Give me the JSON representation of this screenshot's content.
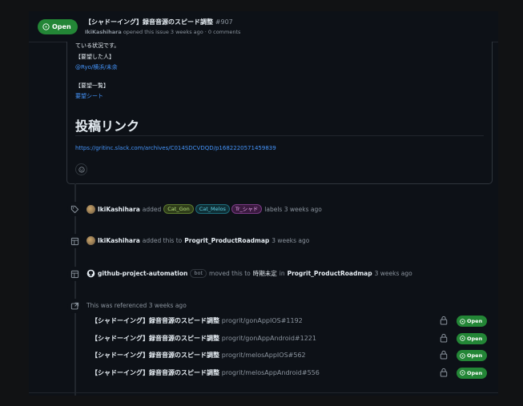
{
  "header": {
    "state_label": "Open",
    "title": "【シャドーイング】録音音源のスピード調整",
    "number": "#907",
    "author": "IkiKashihara",
    "meta": "opened this issue 3 weeks ago · 0 comments"
  },
  "comment": {
    "line1": "ている状況です。",
    "requester_heading": "【要望した人】",
    "requester_link": "@Ryo/横浜/未余",
    "list_heading": "【要望一覧】",
    "list_link": "要望シート",
    "post_heading": "投稿リンク",
    "post_url": "https://gritinc.slack.com/archives/C014SDCVDQD/p1682220571459839"
  },
  "timeline": {
    "labels_event": {
      "actor": "IkiKashihara",
      "verb": "added",
      "labels": [
        {
          "name": "Cat_Gon",
          "bg": "#2f3d1a",
          "fg": "#b4e07a",
          "border": "#5c7a2e"
        },
        {
          "name": "Cat_Melos",
          "bg": "#0f2f36",
          "fg": "#5fd1e6",
          "border": "#1d6b7a"
        },
        {
          "name": "Tr_シャド",
          "bg": "#3a1a3f",
          "fg": "#e9a3f0",
          "border": "#7a3a85"
        }
      ],
      "suffix": "labels 3 weeks ago"
    },
    "project_event": {
      "actor": "IkiKashihara",
      "text": "added this to",
      "project": "Progrit_ProductRoadmap",
      "time": "3 weeks ago"
    },
    "move_event": {
      "actor": "github-project-automation",
      "badge": "bot",
      "text": "moved this to",
      "column": "時期未定",
      "in_text": "in",
      "project": "Progrit_ProductRoadmap",
      "time": "3 weeks ago"
    },
    "referenced": {
      "text": "This was referenced 3 weeks ago",
      "items": [
        {
          "title": "【シャドーイング】録音音源のスピード調整",
          "repo": "progrit/gonAppIOS#1192",
          "state": "Open"
        },
        {
          "title": "【シャドーイング】録音音源のスピード調整",
          "repo": "progrit/gonAppAndroid#1221",
          "state": "Open"
        },
        {
          "title": "【シャドーイング】録音音源のスピード調整",
          "repo": "progrit/melosAppIOS#562",
          "state": "Open"
        },
        {
          "title": "【シャドーイング】録音音源のスピード調整",
          "repo": "progrit/melosAppAndroid#556",
          "state": "Open"
        }
      ]
    }
  },
  "colors": {
    "open_green": "#238636",
    "link_blue": "#4493f8",
    "bg": "#0d1117",
    "border": "#30363d"
  }
}
